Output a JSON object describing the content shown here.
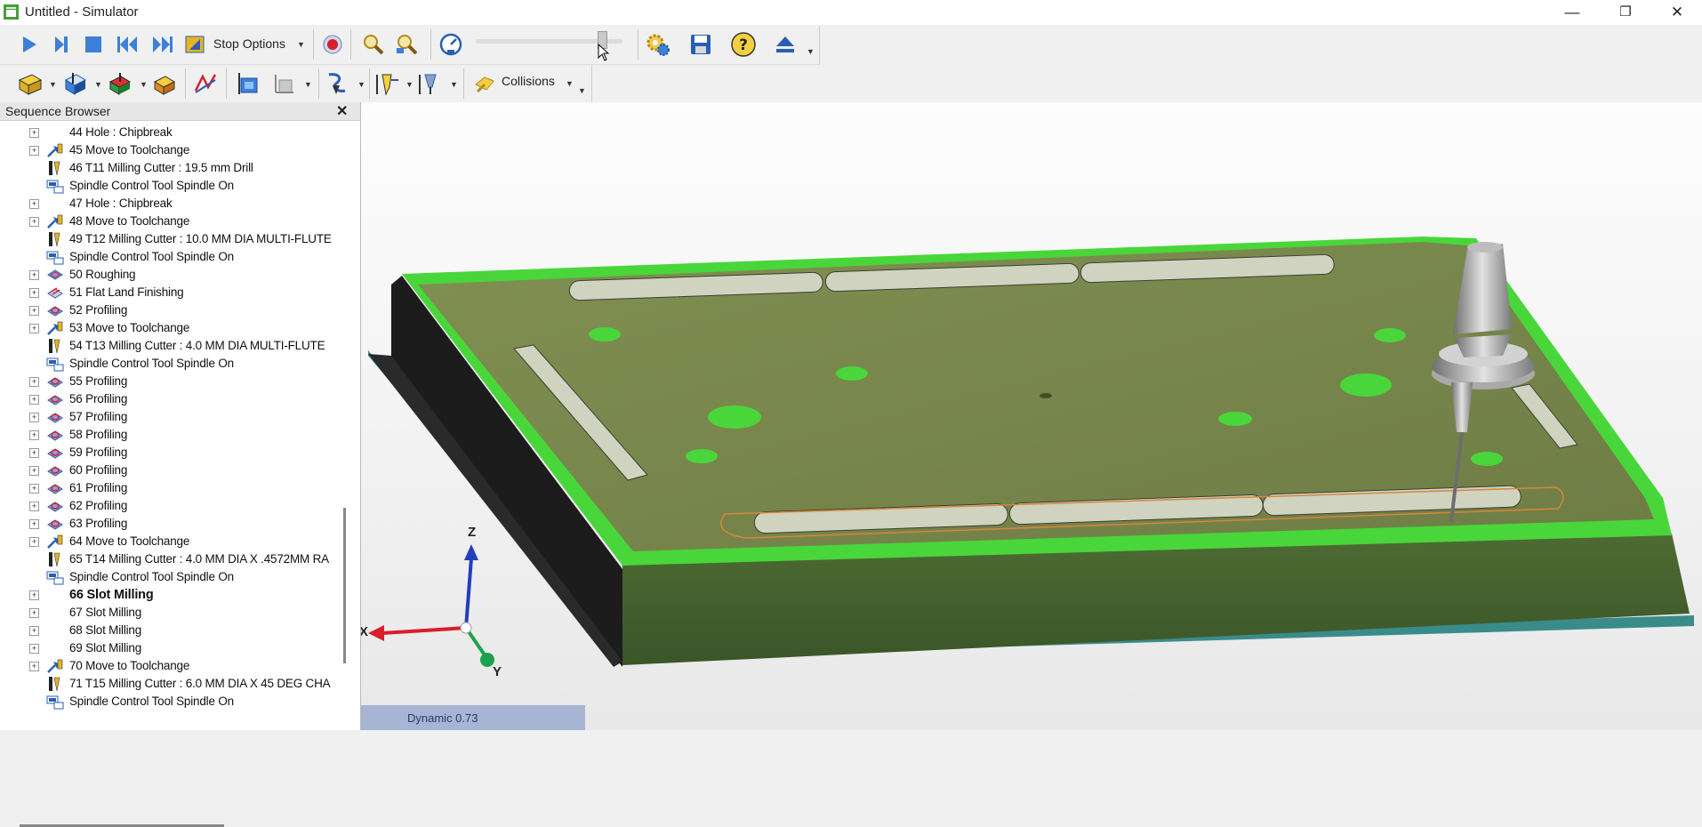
{
  "window": {
    "title": "Untitled - Simulator",
    "minimize": "—",
    "restore": "❐",
    "close": "✕"
  },
  "toolbar1": {
    "stop_options_label": "Stop Options",
    "buttons": [
      "play-icon",
      "step-icon",
      "stop-icon",
      "rewind-icon",
      "fast-forward-icon",
      "stop-options-icon",
      "record-icon",
      "zoom-icon",
      "zoom-fit-icon",
      "speed-icon",
      "settings-icon",
      "save-icon",
      "help-icon",
      "eject-icon"
    ]
  },
  "toolbar2": {
    "collisions_label": "Collisions"
  },
  "sequence_browser": {
    "title": "Sequence Browser",
    "close": "✕",
    "rows": [
      {
        "text": "44 Hole : Chipbreak",
        "icon": "none",
        "expander": true,
        "bold": false
      },
      {
        "text": "45 Move to Toolchange",
        "icon": "move-icon",
        "expander": true,
        "bold": false
      },
      {
        "text": "46 T11 Milling Cutter : 19.5 mm Drill",
        "icon": "tool-icon",
        "expander": false,
        "bold": false
      },
      {
        "text": "Spindle Control Tool Spindle On",
        "icon": "spindle-icon",
        "expander": false,
        "bold": false
      },
      {
        "text": "47 Hole : Chipbreak",
        "icon": "none",
        "expander": true,
        "bold": false
      },
      {
        "text": "48 Move to Toolchange",
        "icon": "move-icon",
        "expander": true,
        "bold": false
      },
      {
        "text": "49 T12 Milling Cutter : 10.0 MM DIA MULTI-FLUTE",
        "icon": "tool-icon",
        "expander": false,
        "bold": false
      },
      {
        "text": "Spindle Control Tool Spindle On",
        "icon": "spindle-icon",
        "expander": false,
        "bold": false
      },
      {
        "text": "50 Roughing",
        "icon": "roughing-icon",
        "expander": true,
        "bold": false
      },
      {
        "text": "51 Flat Land Finishing",
        "icon": "finishing-icon",
        "expander": true,
        "bold": false
      },
      {
        "text": "52 Profiling",
        "icon": "profiling-icon",
        "expander": true,
        "bold": false
      },
      {
        "text": "53 Move to Toolchange",
        "icon": "move-icon",
        "expander": true,
        "bold": false
      },
      {
        "text": "54 T13 Milling Cutter : 4.0 MM DIA MULTI-FLUTE",
        "icon": "tool-icon",
        "expander": false,
        "bold": false
      },
      {
        "text": "Spindle Control Tool Spindle On",
        "icon": "spindle-icon",
        "expander": false,
        "bold": false
      },
      {
        "text": "55 Profiling",
        "icon": "profiling-icon",
        "expander": true,
        "bold": false
      },
      {
        "text": "56 Profiling",
        "icon": "profiling-icon",
        "expander": true,
        "bold": false
      },
      {
        "text": "57 Profiling",
        "icon": "profiling-icon",
        "expander": true,
        "bold": false
      },
      {
        "text": "58 Profiling",
        "icon": "profiling-icon",
        "expander": true,
        "bold": false
      },
      {
        "text": "59 Profiling",
        "icon": "profiling-icon",
        "expander": true,
        "bold": false
      },
      {
        "text": "60 Profiling",
        "icon": "profiling-icon",
        "expander": true,
        "bold": false
      },
      {
        "text": "61 Profiling",
        "icon": "profiling-icon",
        "expander": true,
        "bold": false
      },
      {
        "text": "62 Profiling",
        "icon": "profiling-icon",
        "expander": true,
        "bold": false
      },
      {
        "text": "63 Profiling",
        "icon": "profiling-icon",
        "expander": true,
        "bold": false
      },
      {
        "text": "64 Move to Toolchange",
        "icon": "move-icon",
        "expander": true,
        "bold": false
      },
      {
        "text": "65 T14 Milling Cutter : 4.0 MM DIA X .4572MM RA",
        "icon": "tool-icon",
        "expander": false,
        "bold": false
      },
      {
        "text": "Spindle Control Tool Spindle On",
        "icon": "spindle-icon",
        "expander": false,
        "bold": false
      },
      {
        "text": "66 Slot Milling",
        "icon": "none",
        "expander": true,
        "bold": true
      },
      {
        "text": "67 Slot Milling",
        "icon": "none",
        "expander": true,
        "bold": false
      },
      {
        "text": "68 Slot Milling",
        "icon": "none",
        "expander": true,
        "bold": false
      },
      {
        "text": "69 Slot Milling",
        "icon": "none",
        "expander": true,
        "bold": false
      },
      {
        "text": "70 Move to Toolchange",
        "icon": "move-icon",
        "expander": true,
        "bold": false
      },
      {
        "text": "71 T15 Milling Cutter : 6.0 MM DIA X 45 DEG CHA",
        "icon": "tool-icon",
        "expander": false,
        "bold": false
      },
      {
        "text": "Spindle Control Tool Spindle On",
        "icon": "spindle-icon",
        "expander": false,
        "bold": false
      }
    ]
  },
  "viewport": {
    "axes": {
      "x": "X",
      "y": "Y",
      "z": "Z"
    },
    "status": "Dynamic 0.73"
  },
  "colors": {
    "part_top": "#77874a",
    "part_edge": "#49d63a",
    "fixture": "#1b1b1b",
    "status_bg": "#a6b5d4"
  }
}
